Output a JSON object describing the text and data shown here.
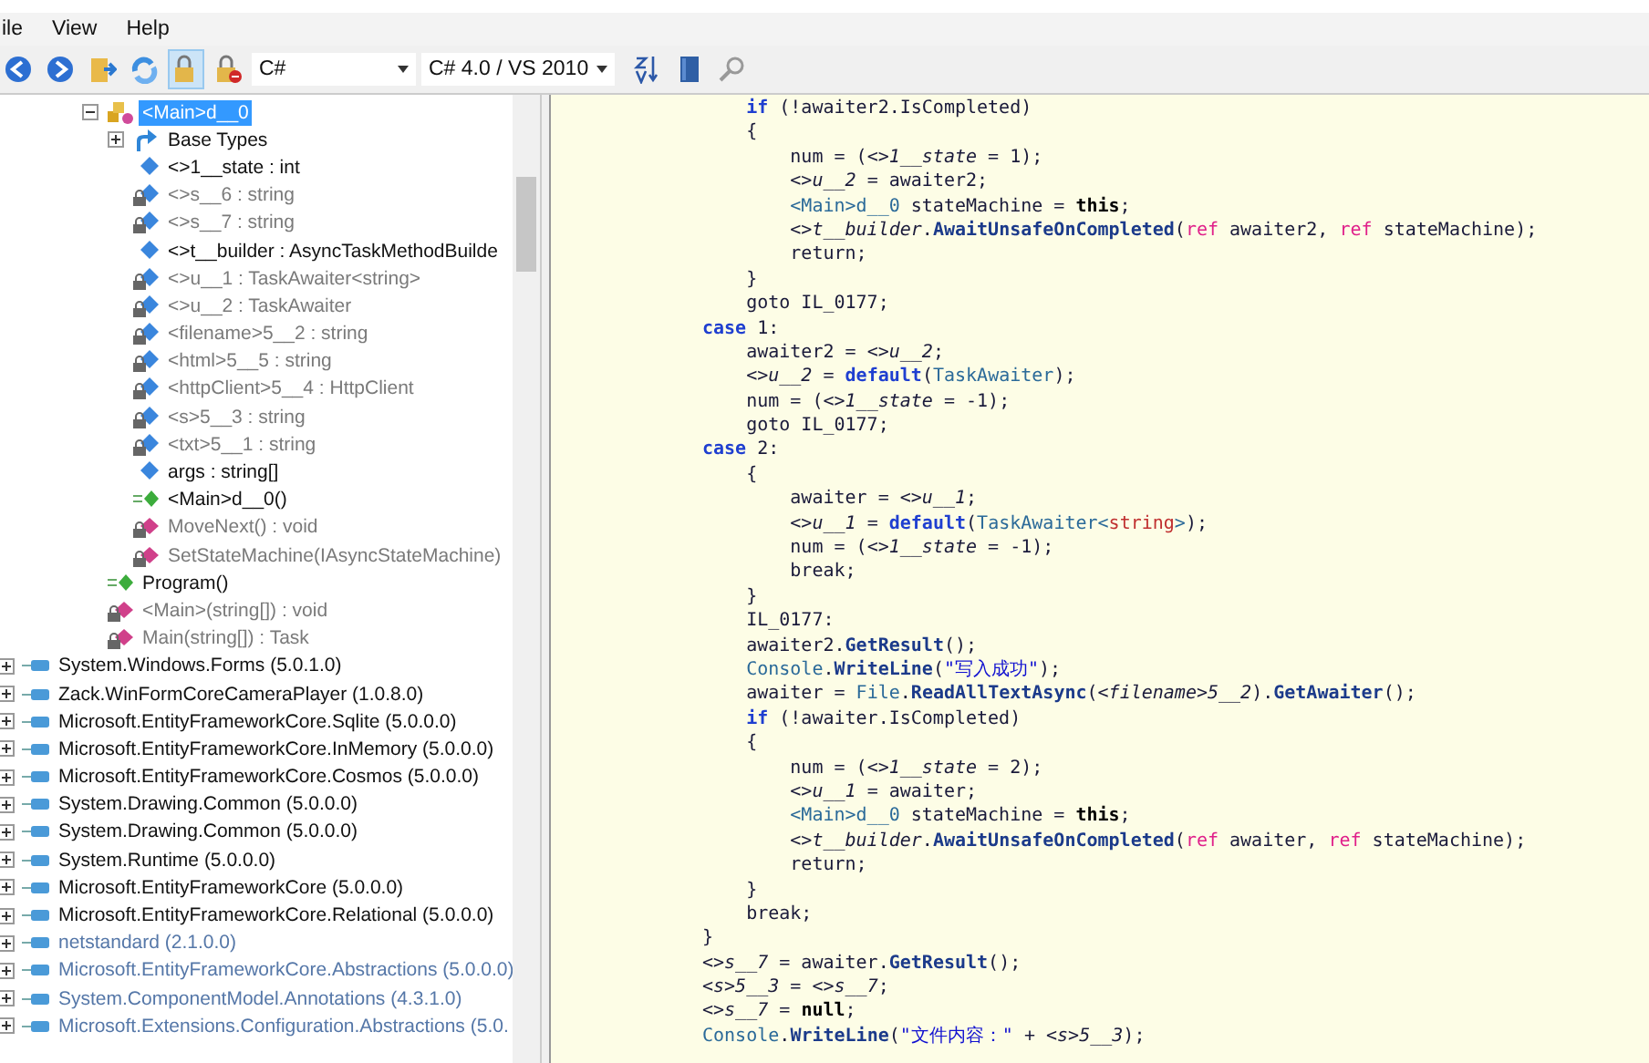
{
  "menu": [
    {
      "label": "ile"
    },
    {
      "label": "View"
    },
    {
      "label": "Help"
    }
  ],
  "toolbar": {
    "buttons": [
      {
        "kind": "back",
        "pressed": false
      },
      {
        "kind": "forward",
        "pressed": false
      },
      {
        "kind": "open",
        "pressed": false
      },
      {
        "kind": "refresh",
        "pressed": false
      },
      {
        "kind": "lock",
        "pressed": true
      },
      {
        "kind": "lock-blocked",
        "pressed": false
      }
    ],
    "language": "C#",
    "version": "C# 4.0 / VS 2010",
    "tools": [
      {
        "kind": "sort"
      },
      {
        "kind": "book"
      },
      {
        "kind": "search"
      }
    ]
  },
  "tree": {
    "class_members": [
      {
        "label": "<Main>d__0",
        "kind": "class",
        "selected": true,
        "faded": false,
        "expanded": true,
        "children": [
          {
            "label": "Base Types",
            "kind": "base-types",
            "selected": false,
            "faded": false,
            "expanded": false
          },
          {
            "label": "<>1__state : int",
            "kind": "field",
            "selected": false,
            "faded": false
          },
          {
            "label": "<>s__6 : string",
            "kind": "private-field",
            "selected": false,
            "faded": true
          },
          {
            "label": "<>s__7 : string",
            "kind": "private-field",
            "selected": false,
            "faded": true
          },
          {
            "label": "<>t__builder : AsyncTaskMethodBuilde",
            "kind": "field",
            "selected": false,
            "faded": false
          },
          {
            "label": "<>u__1 : TaskAwaiter<string>",
            "kind": "private-field",
            "selected": false,
            "faded": true
          },
          {
            "label": "<>u__2 : TaskAwaiter",
            "kind": "private-field",
            "selected": false,
            "faded": true
          },
          {
            "label": "<filename>5__2 : string",
            "kind": "private-field",
            "selected": false,
            "faded": true
          },
          {
            "label": "<html>5__5 : string",
            "kind": "private-field",
            "selected": false,
            "faded": true
          },
          {
            "label": "<httpClient>5__4 : HttpClient",
            "kind": "private-field",
            "selected": false,
            "faded": true
          },
          {
            "label": "<s>5__3 : string",
            "kind": "private-field",
            "selected": false,
            "faded": true
          },
          {
            "label": "<txt>5__1 : string",
            "kind": "private-field",
            "selected": false,
            "faded": true
          },
          {
            "label": "args : string[]",
            "kind": "field",
            "selected": false,
            "faded": false
          },
          {
            "label": "<Main>d__0()",
            "kind": "constructor",
            "selected": false,
            "faded": false
          },
          {
            "label": "MoveNext() : void",
            "kind": "private-method",
            "selected": false,
            "faded": true
          },
          {
            "label": "SetStateMachine(IAsyncStateMachine)",
            "kind": "private-method",
            "selected": false,
            "faded": true
          }
        ]
      },
      {
        "label": "Program()",
        "kind": "constructor",
        "selected": false,
        "faded": false
      },
      {
        "label": "<Main>(string[]) : void",
        "kind": "private-static-method",
        "selected": false,
        "faded": true
      },
      {
        "label": "Main(string[]) : Task",
        "kind": "private-static-method",
        "selected": false,
        "faded": true
      }
    ],
    "assemblies": [
      {
        "label": "System.Windows.Forms (5.0.1.0)",
        "faded": false,
        "expanded": false
      },
      {
        "label": "Zack.WinFormCoreCameraPlayer (1.0.8.0)",
        "faded": false,
        "expanded": false
      },
      {
        "label": "Microsoft.EntityFrameworkCore.Sqlite (5.0.0.0)",
        "faded": false,
        "expanded": false
      },
      {
        "label": "Microsoft.EntityFrameworkCore.InMemory (5.0.0.0)",
        "faded": false,
        "expanded": false
      },
      {
        "label": "Microsoft.EntityFrameworkCore.Cosmos (5.0.0.0)",
        "faded": false,
        "expanded": false
      },
      {
        "label": "System.Drawing.Common (5.0.0.0)",
        "faded": false,
        "expanded": false
      },
      {
        "label": "System.Drawing.Common (5.0.0.0)",
        "faded": false,
        "expanded": false
      },
      {
        "label": "System.Runtime (5.0.0.0)",
        "faded": false,
        "expanded": false
      },
      {
        "label": "Microsoft.EntityFrameworkCore (5.0.0.0)",
        "faded": false,
        "expanded": false
      },
      {
        "label": "Microsoft.EntityFrameworkCore.Relational (5.0.0.0)",
        "faded": false,
        "expanded": false
      },
      {
        "label": "netstandard (2.1.0.0)",
        "faded": true,
        "expanded": false
      },
      {
        "label": "Microsoft.EntityFrameworkCore.Abstractions (5.0.0.0)",
        "faded": true,
        "expanded": false
      },
      {
        "label": "System.ComponentModel.Annotations (4.3.1.0)",
        "faded": true,
        "expanded": false
      },
      {
        "label": "Microsoft.Extensions.Configuration.Abstractions (5.0.",
        "faded": true,
        "expanded": false
      }
    ]
  },
  "code": [
    {
      "tokens": [
        {
          "kind": "keyword",
          "text": "    if"
        },
        {
          "kind": "plain",
          "text": " (!awaiter2.IsCompleted)"
        }
      ]
    },
    {
      "tokens": [
        {
          "kind": "plain",
          "text": "    {"
        }
      ]
    },
    {
      "tokens": [
        {
          "kind": "plain",
          "text": "        num = ("
        },
        {
          "kind": "field",
          "text": "<>1__state"
        },
        {
          "kind": "plain",
          "text": " = 1);"
        }
      ]
    },
    {
      "tokens": [
        {
          "kind": "field",
          "text": "        <>u__2"
        },
        {
          "kind": "plain",
          "text": " = awaiter2;"
        }
      ]
    },
    {
      "tokens": [
        {
          "kind": "type",
          "text": "        <Main>d__0"
        },
        {
          "kind": "plain",
          "text": " stateMachine = "
        },
        {
          "kind": "literal",
          "text": "this"
        },
        {
          "kind": "plain",
          "text": ";"
        }
      ]
    },
    {
      "tokens": [
        {
          "kind": "field",
          "text": "        <>t__builder"
        },
        {
          "kind": "plain",
          "text": "."
        },
        {
          "kind": "method",
          "text": "AwaitUnsafeOnCompleted"
        },
        {
          "kind": "plain",
          "text": "("
        },
        {
          "kind": "modifier",
          "text": "ref"
        },
        {
          "kind": "plain",
          "text": " awaiter2, "
        },
        {
          "kind": "modifier",
          "text": "ref"
        },
        {
          "kind": "plain",
          "text": " stateMachine);"
        }
      ]
    },
    {
      "tokens": [
        {
          "kind": "plain",
          "text": "        return;"
        }
      ]
    },
    {
      "tokens": [
        {
          "kind": "plain",
          "text": "    }"
        }
      ]
    },
    {
      "tokens": [
        {
          "kind": "plain",
          "text": "    goto IL_0177;"
        }
      ]
    },
    {
      "tokens": [
        {
          "kind": "keyword",
          "text": "case"
        },
        {
          "kind": "plain",
          "text": " 1:"
        }
      ]
    },
    {
      "tokens": [
        {
          "kind": "plain",
          "text": "    awaiter2 = "
        },
        {
          "kind": "field",
          "text": "<>u__2"
        },
        {
          "kind": "plain",
          "text": ";"
        }
      ]
    },
    {
      "tokens": [
        {
          "kind": "field",
          "text": "    <>u__2"
        },
        {
          "kind": "plain",
          "text": " = "
        },
        {
          "kind": "keyword",
          "text": "default"
        },
        {
          "kind": "plain",
          "text": "("
        },
        {
          "kind": "type",
          "text": "TaskAwaiter"
        },
        {
          "kind": "plain",
          "text": ");"
        }
      ]
    },
    {
      "tokens": [
        {
          "kind": "plain",
          "text": "    num = ("
        },
        {
          "kind": "field",
          "text": "<>1__state"
        },
        {
          "kind": "plain",
          "text": " = -1);"
        }
      ]
    },
    {
      "tokens": [
        {
          "kind": "plain",
          "text": "    goto IL_0177;"
        }
      ]
    },
    {
      "tokens": [
        {
          "kind": "keyword",
          "text": "case"
        },
        {
          "kind": "plain",
          "text": " 2:"
        }
      ]
    },
    {
      "tokens": [
        {
          "kind": "plain",
          "text": "    {"
        }
      ]
    },
    {
      "tokens": [
        {
          "kind": "plain",
          "text": "        awaiter = "
        },
        {
          "kind": "field",
          "text": "<>u__1"
        },
        {
          "kind": "plain",
          "text": ";"
        }
      ]
    },
    {
      "tokens": [
        {
          "kind": "field",
          "text": "        <>u__1"
        },
        {
          "kind": "plain",
          "text": " = "
        },
        {
          "kind": "keyword",
          "text": "default"
        },
        {
          "kind": "plain",
          "text": "("
        },
        {
          "kind": "type",
          "text": "TaskAwaiter<"
        },
        {
          "kind": "builtin",
          "text": "string"
        },
        {
          "kind": "type",
          "text": ">"
        },
        {
          "kind": "plain",
          "text": ");"
        }
      ]
    },
    {
      "tokens": [
        {
          "kind": "plain",
          "text": "        num = ("
        },
        {
          "kind": "field",
          "text": "<>1__state"
        },
        {
          "kind": "plain",
          "text": " = -1);"
        }
      ]
    },
    {
      "tokens": [
        {
          "kind": "plain",
          "text": "        break;"
        }
      ]
    },
    {
      "tokens": [
        {
          "kind": "plain",
          "text": "    }"
        }
      ]
    },
    {
      "tokens": [
        {
          "kind": "plain",
          "text": "    IL_0177:"
        }
      ]
    },
    {
      "tokens": [
        {
          "kind": "plain",
          "text": "    awaiter2."
        },
        {
          "kind": "method",
          "text": "GetResult"
        },
        {
          "kind": "plain",
          "text": "();"
        }
      ]
    },
    {
      "tokens": [
        {
          "kind": "type",
          "text": "    Console"
        },
        {
          "kind": "plain",
          "text": "."
        },
        {
          "kind": "method",
          "text": "WriteLine"
        },
        {
          "kind": "plain",
          "text": "("
        },
        {
          "kind": "string",
          "text": "\"写入成功\""
        },
        {
          "kind": "plain",
          "text": ");"
        }
      ]
    },
    {
      "tokens": [
        {
          "kind": "plain",
          "text": "    awaiter = "
        },
        {
          "kind": "type",
          "text": "File"
        },
        {
          "kind": "plain",
          "text": "."
        },
        {
          "kind": "method",
          "text": "ReadAllTextAsync"
        },
        {
          "kind": "plain",
          "text": "("
        },
        {
          "kind": "field",
          "text": "<filename>5__2"
        },
        {
          "kind": "plain",
          "text": ")."
        },
        {
          "kind": "method",
          "text": "GetAwaiter"
        },
        {
          "kind": "plain",
          "text": "();"
        }
      ]
    },
    {
      "tokens": [
        {
          "kind": "keyword",
          "text": "    if"
        },
        {
          "kind": "plain",
          "text": " (!awaiter.IsCompleted)"
        }
      ]
    },
    {
      "tokens": [
        {
          "kind": "plain",
          "text": "    {"
        }
      ]
    },
    {
      "tokens": [
        {
          "kind": "plain",
          "text": "        num = ("
        },
        {
          "kind": "field",
          "text": "<>1__state"
        },
        {
          "kind": "plain",
          "text": " = 2);"
        }
      ]
    },
    {
      "tokens": [
        {
          "kind": "field",
          "text": "        <>u__1"
        },
        {
          "kind": "plain",
          "text": " = awaiter;"
        }
      ]
    },
    {
      "tokens": [
        {
          "kind": "type",
          "text": "        <Main>d__0"
        },
        {
          "kind": "plain",
          "text": " stateMachine = "
        },
        {
          "kind": "literal",
          "text": "this"
        },
        {
          "kind": "plain",
          "text": ";"
        }
      ]
    },
    {
      "tokens": [
        {
          "kind": "field",
          "text": "        <>t__builder"
        },
        {
          "kind": "plain",
          "text": "."
        },
        {
          "kind": "method",
          "text": "AwaitUnsafeOnCompleted"
        },
        {
          "kind": "plain",
          "text": "("
        },
        {
          "kind": "modifier",
          "text": "ref"
        },
        {
          "kind": "plain",
          "text": " awaiter, "
        },
        {
          "kind": "modifier",
          "text": "ref"
        },
        {
          "kind": "plain",
          "text": " stateMachine);"
        }
      ]
    },
    {
      "tokens": [
        {
          "kind": "plain",
          "text": "        return;"
        }
      ]
    },
    {
      "tokens": [
        {
          "kind": "plain",
          "text": "    }"
        }
      ]
    },
    {
      "tokens": [
        {
          "kind": "plain",
          "text": "    break;"
        }
      ]
    },
    {
      "tokens": [
        {
          "kind": "plain",
          "text": "}"
        }
      ]
    },
    {
      "tokens": [
        {
          "kind": "field",
          "text": "<>s__7"
        },
        {
          "kind": "plain",
          "text": " = awaiter."
        },
        {
          "kind": "method",
          "text": "GetResult"
        },
        {
          "kind": "plain",
          "text": "();"
        }
      ]
    },
    {
      "tokens": [
        {
          "kind": "field",
          "text": "<s>5__3"
        },
        {
          "kind": "plain",
          "text": " = "
        },
        {
          "kind": "field",
          "text": "<>s__7"
        },
        {
          "kind": "plain",
          "text": ";"
        }
      ]
    },
    {
      "tokens": [
        {
          "kind": "field",
          "text": "<>s__7"
        },
        {
          "kind": "plain",
          "text": " = "
        },
        {
          "kind": "literal",
          "text": "null"
        },
        {
          "kind": "plain",
          "text": ";"
        }
      ]
    },
    {
      "tokens": [
        {
          "kind": "type",
          "text": "Console"
        },
        {
          "kind": "plain",
          "text": "."
        },
        {
          "kind": "method",
          "text": "WriteLine"
        },
        {
          "kind": "plain",
          "text": "("
        },
        {
          "kind": "string",
          "text": "\"文件内容：\""
        },
        {
          "kind": "plain",
          "text": " + "
        },
        {
          "kind": "field",
          "text": "<s>5__3"
        },
        {
          "kind": "plain",
          "text": ");"
        }
      ]
    }
  ]
}
